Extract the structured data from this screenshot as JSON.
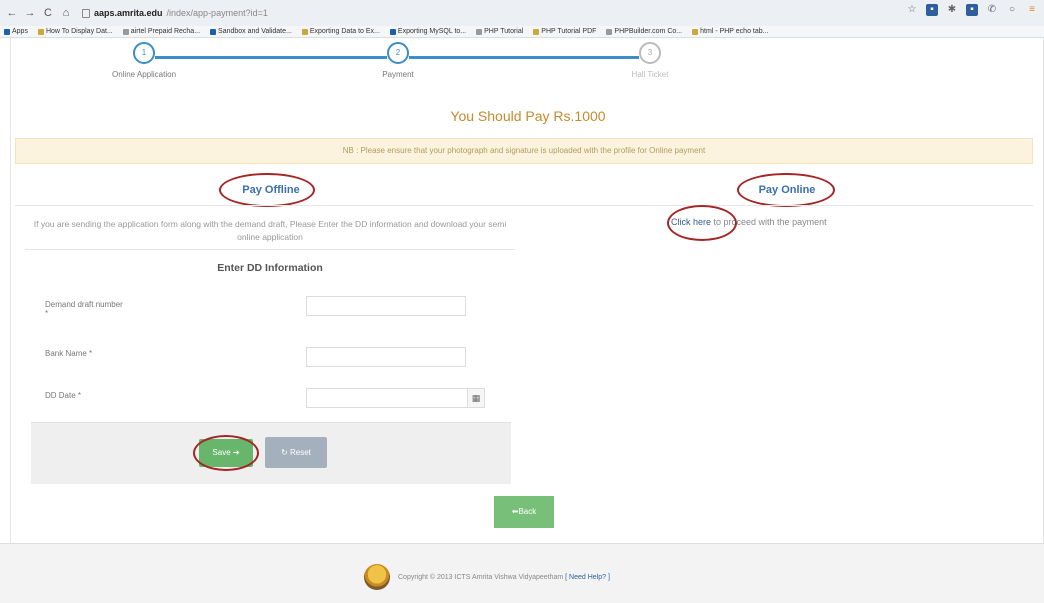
{
  "browser": {
    "nav": {
      "back": "←",
      "forward": "→",
      "reload": "C",
      "home": "⌂"
    },
    "url_host": "aaps.amrita.edu",
    "url_path": "/index/app-payment?id=1",
    "bookmarks": [
      {
        "icon": "apps-icon",
        "label": "Apps"
      },
      {
        "icon": "bookmark-icon",
        "label": "How To Display Dat..."
      },
      {
        "icon": "page-icon",
        "label": "airtel Prepaid Recha..."
      },
      {
        "icon": "page-icon",
        "label": "Sandbox and Validate..."
      },
      {
        "icon": "page-icon",
        "label": "Exporting Data to Ex..."
      },
      {
        "icon": "page-icon",
        "label": "Exporting MySQL to..."
      },
      {
        "icon": "page-icon",
        "label": "PHP Tutorial"
      },
      {
        "icon": "page-icon",
        "label": "PHP Tutorial PDF"
      },
      {
        "icon": "page-icon",
        "label": "PHPBuilder.com Co..."
      },
      {
        "icon": "page-icon",
        "label": "html - PHP echo tab..."
      }
    ]
  },
  "stepper": {
    "steps": [
      {
        "number": "1",
        "label": "Online Application"
      },
      {
        "number": "2",
        "label": "Payment"
      },
      {
        "number": "3",
        "label": "Hall Ticket"
      }
    ]
  },
  "payment": {
    "amount_text": "You Should Pay Rs.1000",
    "notice": "NB : Please ensure that your photograph and signature is uploaded with the profile for Online payment"
  },
  "offline": {
    "title": "Pay Offline",
    "description": "If you are sending the application form along with the demand draft, Please Enter the DD information and download your semi online application",
    "form_title": "Enter DD Information",
    "fields": [
      {
        "label": "Demand draft number",
        "required": "*",
        "value": ""
      },
      {
        "label": "Bank Name *",
        "value": ""
      },
      {
        "label": "DD Date *",
        "value": ""
      }
    ],
    "save_label": "Save ➔",
    "reset_label": "↻ Reset"
  },
  "online": {
    "title": "Pay Online",
    "link_text": "Click here",
    "after_link": " to proceed with the payment"
  },
  "back_label": "⬅Back",
  "footer": {
    "copyright": "Copyright © 2013 ICTS Amrita Vishwa Vidyapeetham",
    "help": "[ Need Help? ]"
  }
}
